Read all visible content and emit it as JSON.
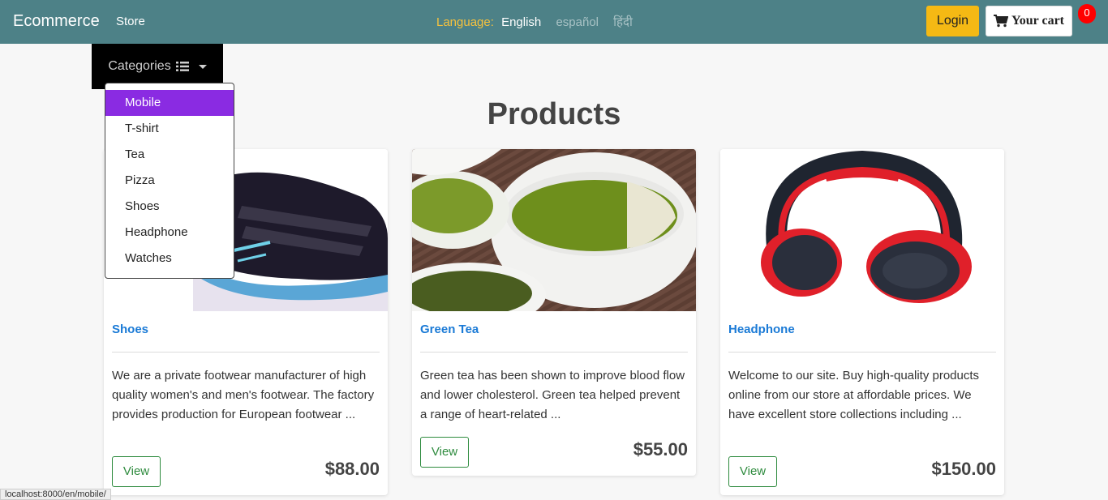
{
  "nav": {
    "brand": "Ecommerce",
    "store": "Store",
    "language_label": "Language:",
    "lang_active": "English",
    "lang_es": "español",
    "lang_hi": "हिंदी",
    "login": "Login",
    "cart": "Your cart",
    "cart_count": "0"
  },
  "categories": {
    "label": "Categories",
    "items": [
      "Mobile",
      "T-shirt",
      "Tea",
      "Pizza",
      "Shoes",
      "Headphone",
      "Watches"
    ]
  },
  "heading": "Products",
  "products": [
    {
      "title": "Shoes",
      "desc": "We are a private footwear manufacturer of high quality women's and men's footwear. The factory provides production for European footwear ...",
      "view": "View",
      "price": "$88.00"
    },
    {
      "title": "Green Tea",
      "desc": "Green tea has been shown to improve blood flow and lower cholesterol. Green tea helped prevent a range of heart-related ...",
      "view": "View",
      "price": "$55.00"
    },
    {
      "title": "Headphone",
      "desc": "Welcome to our site. Buy high-quality products online from our store at affordable prices. We have excellent store collections including ...",
      "view": "View",
      "price": "$150.00"
    }
  ],
  "status_url": "localhost:8000/en/mobile/",
  "colors": {
    "navbar": "#4d8187",
    "login": "#f5b914",
    "dropdown_active": "#8a2be2",
    "title_link": "#1a7ad6",
    "view_button": "#2e8b3e"
  }
}
